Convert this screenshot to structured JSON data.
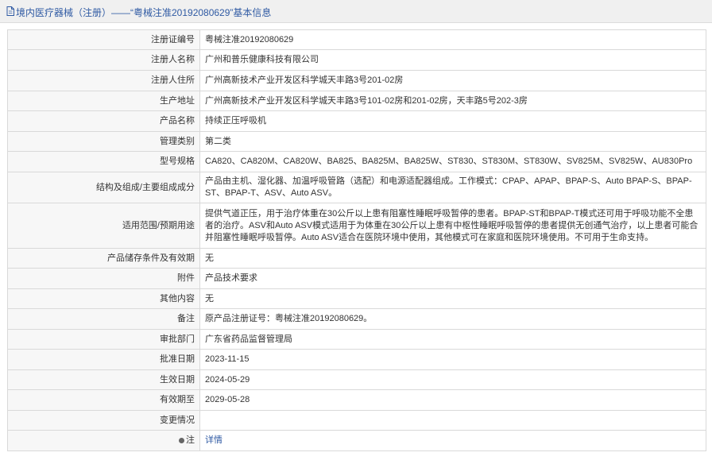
{
  "header": {
    "icon": "document-icon",
    "title": "境内医疗器械（注册）——“粤械注准20192080629”基本信息"
  },
  "rows": [
    {
      "label": "注册证编号",
      "value": "粤械注准20192080629"
    },
    {
      "label": "注册人名称",
      "value": "广州和普乐健康科技有限公司"
    },
    {
      "label": "注册人住所",
      "value": "广州高新技术产业开发区科学城天丰路3号201-02房"
    },
    {
      "label": "生产地址",
      "value": "广州高新技术产业开发区科学城天丰路3号101-02房和201-02房，天丰路5号202-3房"
    },
    {
      "label": "产品名称",
      "value": "持续正压呼吸机"
    },
    {
      "label": "管理类别",
      "value": "第二类"
    },
    {
      "label": "型号规格",
      "value": "CA820、CA820M、CA820W、BA825、BA825M、BA825W、ST830、ST830M、ST830W、SV825M、SV825W、AU830Pro"
    },
    {
      "label": "结构及组成/主要组成成分",
      "value": "产品由主机、湿化器、加温呼吸管路（选配）和电源适配器组成。工作模式：CPAP、APAP、BPAP-S、Auto BPAP-S、BPAP-ST、BPAP-T、ASV、Auto ASV。"
    },
    {
      "label": "适用范围/预期用途",
      "value": "提供气道正压，用于治疗体重在30公斤以上患有阻塞性睡眠呼吸暂停的患者。BPAP-ST和BPAP-T模式还可用于呼吸功能不全患者的治疗。ASV和Auto ASV模式适用于为体重在30公斤以上患有中枢性睡眠呼吸暂停的患者提供无创通气治疗，以上患者可能合并阻塞性睡眠呼吸暂停。Auto ASV适合在医院环境中使用，其他模式可在家庭和医院环境使用。不可用于生命支持。"
    },
    {
      "label": "产品储存条件及有效期",
      "value": "无"
    },
    {
      "label": "附件",
      "value": "产品技术要求"
    },
    {
      "label": "其他内容",
      "value": "无"
    },
    {
      "label": "备注",
      "value": "原产品注册证号：粤械注准20192080629。"
    },
    {
      "label": "审批部门",
      "value": "广东省药品监督管理局"
    },
    {
      "label": "批准日期",
      "value": "2023-11-15"
    },
    {
      "label": "生效日期",
      "value": "2024-05-29"
    },
    {
      "label": "有效期至",
      "value": "2029-05-28"
    },
    {
      "label": "变更情况",
      "value": ""
    }
  ],
  "note_row": {
    "icon": "info-icon",
    "label": "注",
    "link_text": "详情"
  }
}
